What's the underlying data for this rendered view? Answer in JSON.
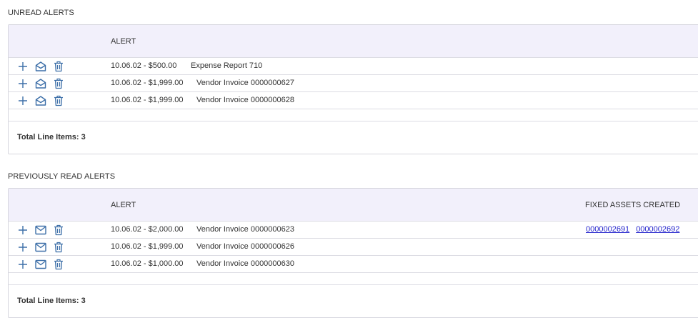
{
  "unread": {
    "title": "UNREAD ALERTS",
    "col_alert": "ALERT",
    "rows": [
      {
        "amount": "10.06.02 - $500.00",
        "doc": "Expense Report 710"
      },
      {
        "amount": "10.06.02 - $1,999.00",
        "doc": "Vendor Invoice 0000000627"
      },
      {
        "amount": "10.06.02 - $1,999.00",
        "doc": "Vendor Invoice 0000000628"
      }
    ],
    "total": "Total Line Items: 3"
  },
  "read": {
    "title": "PREVIOUSLY READ ALERTS",
    "col_alert": "ALERT",
    "col_assets": "FIXED ASSETS CREATED",
    "rows": [
      {
        "amount": "10.06.02 - $2,000.00",
        "doc": "Vendor Invoice 0000000623",
        "assets": [
          "0000002691",
          "0000002692"
        ]
      },
      {
        "amount": "10.06.02 - $1,999.00",
        "doc": "Vendor Invoice 0000000626",
        "assets": []
      },
      {
        "amount": "10.06.02 - $1,000.00",
        "doc": "Vendor Invoice 0000000630",
        "assets": []
      }
    ],
    "total": "Total Line Items: 3"
  },
  "icons": {
    "expand": "plus-icon",
    "mark_read": "envelope-open-icon",
    "mark_unread": "envelope-icon",
    "delete": "trash-icon"
  },
  "colors": {
    "accent": "#3d6fa8",
    "header_bg": "#f2f0fb",
    "link": "#2222cc",
    "border": "#dcdce3"
  }
}
